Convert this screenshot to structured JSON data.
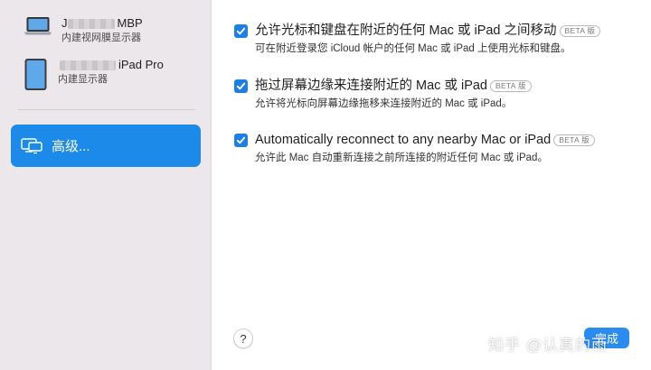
{
  "sidebar": {
    "devices": [
      {
        "name_prefix": "J",
        "name_suffix": "MBP",
        "subtitle": "内建视网膜显示器",
        "icon": "laptop-icon"
      },
      {
        "name_prefix": "",
        "name_suffix": "iPad Pro",
        "subtitle": "内建显示器",
        "icon": "ipad-icon"
      }
    ],
    "advanced": {
      "label": "高级...",
      "icon": "displays-icon"
    }
  },
  "options": [
    {
      "checked": true,
      "title": "允许光标和键盘在附近的任何 Mac 或 iPad 之间移动",
      "badge": "BETA 版",
      "description": "可在附近登录您 iCloud 帐户的任何 Mac 或 iPad 上使用光标和键盘。"
    },
    {
      "checked": true,
      "title": "拖过屏幕边缘来连接附近的 Mac 或 iPad",
      "badge": "BETA 版",
      "description": "允许将光标向屏幕边缘拖移来连接附近的 Mac 或 iPad。"
    },
    {
      "checked": true,
      "title": "Automatically reconnect to any nearby Mac or iPad",
      "badge": "BETA 版",
      "description": "允许此 Mac 自动重新连接之前所连接的附近任何 Mac 或 iPad。"
    }
  ],
  "footer": {
    "help_label": "?",
    "done_label": "完成",
    "watermark": "知乎 @认真的雨"
  },
  "colors": {
    "accent": "#1c8ae8",
    "checkbox": "#1c7fe6",
    "sidebar_bg": "#ece7ea"
  }
}
